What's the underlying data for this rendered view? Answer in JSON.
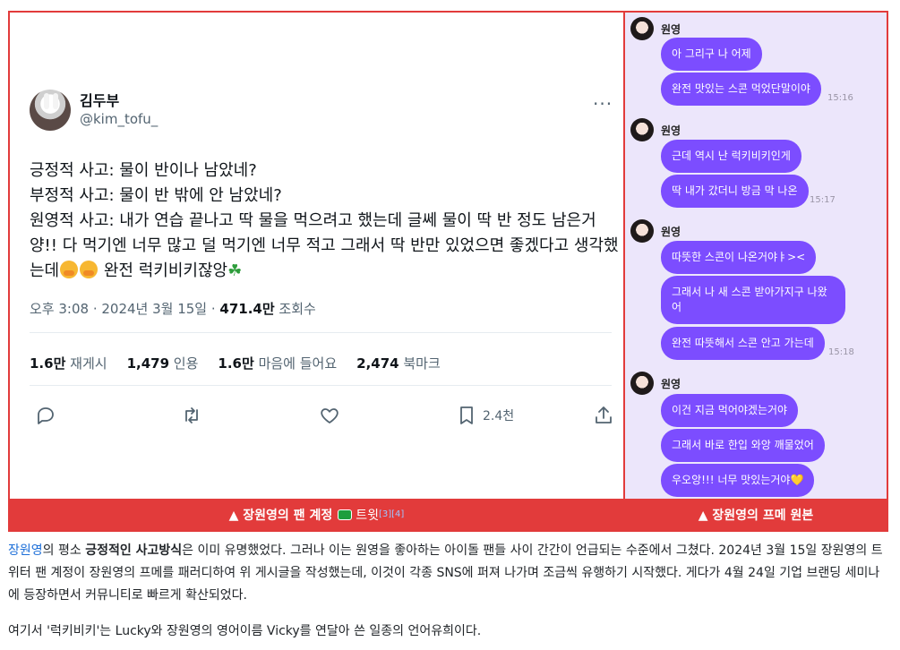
{
  "tweet": {
    "display_name": "김두부",
    "handle": "@kim_tofu_",
    "lines": [
      "긍정적 사고: 물이 반이나 남았네?",
      "부정적 사고: 물이 반 밖에 안 남았네?",
      "원영적 사고: 내가 연습 끝나고 딱 물을 먹으려고 했는데 글쎄 물이 딱 반 정도 남은거",
      "양!! 다 먹기엔 너무 많고 덜 먹기엔 너무 적고 그래서 딱 반만 있었으면 좋겠다고 생각했",
      "는데",
      "완전 럭키비키잖앙"
    ],
    "time": "오후 3:08 · 2024년 3월 15일 · ",
    "views_value": "471.4만",
    "views_label": " 조회수",
    "stats": [
      {
        "value": "1.6만",
        "label": "재게시"
      },
      {
        "value": "1,479",
        "label": "인용"
      },
      {
        "value": "1.6만",
        "label": "마음에 들어요"
      },
      {
        "value": "2,474",
        "label": "북마크"
      }
    ],
    "bookmark_count": "2.4천"
  },
  "chat": {
    "groups": [
      {
        "sender": "원영",
        "messages": [
          "아 그리구 나 어제",
          "완전 맛있는 스콘 먹었단말이야"
        ],
        "time": "15:16"
      },
      {
        "sender": "원영",
        "messages": [
          "근데 역시 난 럭키비키인게",
          "딱 내가 갔더니 방금 막 나온"
        ],
        "time": "15:17"
      },
      {
        "sender": "원영",
        "messages": [
          "따뜻한 스콘이 나온거야ㅑ><",
          "그래서 나 새 스콘 받아가지구 나왔어",
          "완전 따뜻해서 스콘 안고 가는데"
        ],
        "time": "15:18"
      },
      {
        "sender": "원영",
        "messages": [
          "이건 지금 먹어야겠는거야",
          "그래서 바로 한입 와앙 깨물었어",
          "우오앙!!! 너무 맛있는거야💛"
        ],
        "time": ""
      }
    ]
  },
  "captions": {
    "left": "▲ 장원영의 팬 계정",
    "left_link": "트윗",
    "left_refs": "[3][4]",
    "right": "▲ 장원영의 프메 원본"
  },
  "article": {
    "p1_link": "장원영",
    "p1_a": "의 평소 ",
    "p1_bold": "긍정적인 사고방식",
    "p1_b": "은 이미 유명했었다. 그러나 이는 원영을 좋아하는 아이돌 팬들 사이 간간이 언급되는 수준에서 그쳤다. 2024년 3월 15일 장원영의 트위터 팬 계정이 장원영의 프메를 패러디하여 위 게시글을 작성했는데, 이것이 각종 SNS에 퍼져 나가며 조금씩 유행하기 시작했다. 게다가 4월 24일 기업 브랜딩 세미나에 등장하면서 커뮤니티로 빠르게 확산되었다.",
    "p2": "여기서 '럭키비키'는 Lucky와 장원영의 영어이름 Vicky를 연달아 쓴 일종의 언어유희이다."
  }
}
